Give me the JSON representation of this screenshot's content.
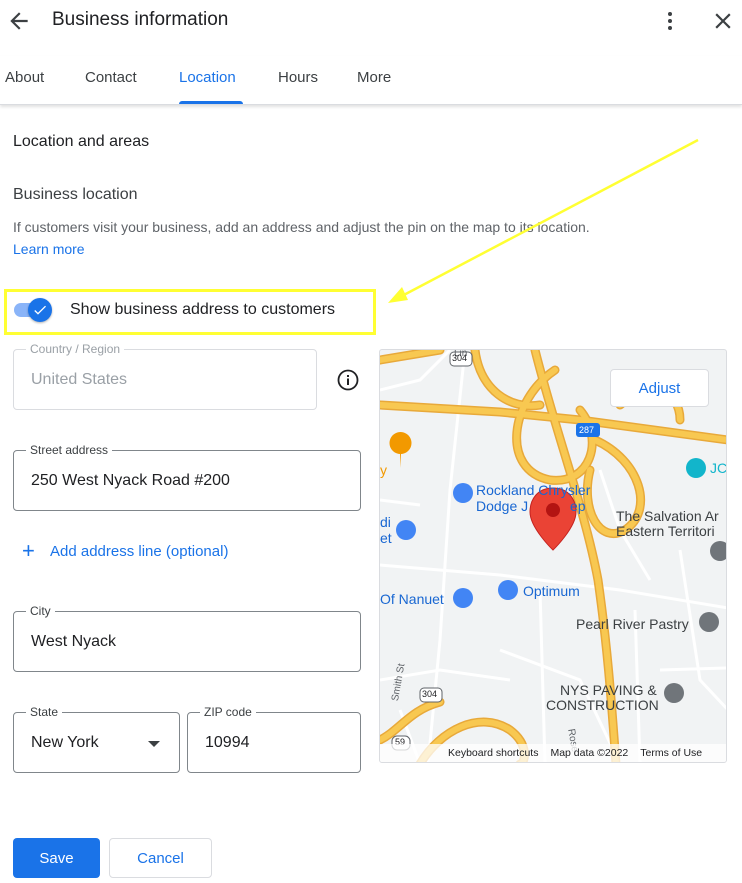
{
  "header": {
    "title": "Business information"
  },
  "tabs": [
    {
      "label": "About"
    },
    {
      "label": "Contact"
    },
    {
      "label": "Location",
      "active": true
    },
    {
      "label": "Hours"
    },
    {
      "label": "More"
    }
  ],
  "section": {
    "title": "Location and areas",
    "subtitle": "Business location",
    "description": "If customers visit your business, add an address and adjust the pin on the map to its location.",
    "learn_more": "Learn more"
  },
  "toggle": {
    "label": "Show business address to customers",
    "checked": true
  },
  "form": {
    "country": {
      "label": "Country / Region",
      "value": "United States"
    },
    "street": {
      "label": "Street address",
      "value": "250 West Nyack Road #200"
    },
    "add_line": "Add address line (optional)",
    "city": {
      "label": "City",
      "value": "West Nyack"
    },
    "state": {
      "label": "State",
      "value": "New York"
    },
    "zip": {
      "label": "ZIP code",
      "value": "10994"
    }
  },
  "map": {
    "adjust": "Adjust",
    "labels": {
      "rockland": "Rockland Chrysler",
      "dodge": "Dodge J",
      "dodge_tail": "ep",
      "salvation1": "The Salvation Ar",
      "salvation2": "Eastern Territori",
      "optimum": "Optimum",
      "nanuet": "Of Nanuet",
      "pearl": "Pearl River Pastry",
      "nys1": "NYS PAVING &",
      "nys2": "CONSTRUCTION",
      "jc": "JC",
      "road_lin": "Lin",
      "smith": "Smith St",
      "rose": "Rose",
      "left_y": "y",
      "left_di": "di",
      "left_et": "et",
      "shield_304a": "304",
      "shield_304b": "304",
      "shield_287": "287",
      "shield_59": "59"
    },
    "footer": {
      "shortcuts": "Keyboard shortcuts",
      "data": "Map data ©2022",
      "terms": "Terms of Use"
    },
    "colors": {
      "highway": "#f8c851",
      "highway_edge": "#e8a93a",
      "land": "#f1f3f4",
      "pin": "#ea4335"
    }
  },
  "actions": {
    "save": "Save",
    "cancel": "Cancel"
  },
  "colors": {
    "accent": "#1a73e8",
    "highlight": "#ffff33"
  }
}
